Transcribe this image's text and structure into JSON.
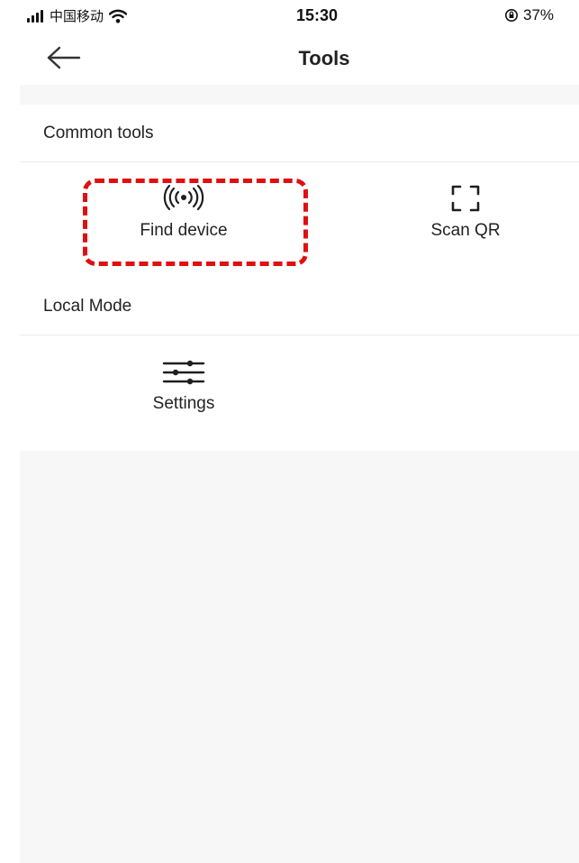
{
  "status_bar": {
    "carrier": "中国移动",
    "time": "15:30",
    "battery": "37%"
  },
  "nav": {
    "title": "Tools"
  },
  "sections": [
    {
      "header": "Common tools",
      "tools": [
        {
          "label": "Find device",
          "icon": "radar-signal-icon"
        },
        {
          "label": "Scan QR",
          "icon": "scan-frame-icon"
        }
      ]
    },
    {
      "header": "Local Mode",
      "tools": [
        {
          "label": "Settings",
          "icon": "sliders-icon"
        }
      ]
    }
  ],
  "annotation": {
    "highlight_color": "#e01010"
  }
}
